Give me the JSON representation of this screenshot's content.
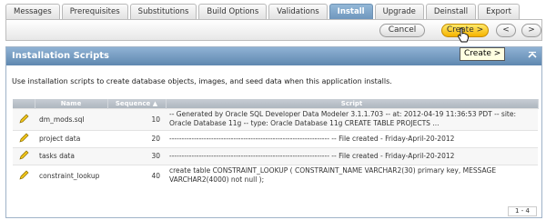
{
  "tabs": [
    "Messages",
    "Prerequisites",
    "Substitutions",
    "Build Options",
    "Validations",
    "Install",
    "Upgrade",
    "Deinstall",
    "Export"
  ],
  "active_tab": "Install",
  "toolbar": {
    "cancel_label": "Cancel",
    "create_label": "Create >",
    "prev_label": "<",
    "next_label": ">"
  },
  "tooltip": "Create >",
  "region": {
    "title": "Installation Scripts",
    "intro": "Use installation scripts to create database objects, images, and seed data when this application installs."
  },
  "table": {
    "headers": [
      "",
      "Name",
      "Sequence",
      "Script"
    ],
    "sort_indicator": "▲",
    "rows": [
      {
        "name": "dm_mods.sql",
        "sequence": "10",
        "script": "-- Generated by Oracle SQL Developer Data Modeler 3.1.1.703 -- at: 2012-04-19 11:36:53 PDT -- site: Oracle Database 11g -- type: Oracle Database 11g CREATE TABLE PROJECTS ..."
      },
      {
        "name": "project data",
        "sequence": "20",
        "script": "----------------------------------------------------------------- -- File created - Friday-April-20-2012"
      },
      {
        "name": "tasks data",
        "sequence": "30",
        "script": "----------------------------------------------------------------- -- File created - Friday-April-20-2012"
      },
      {
        "name": "constraint_lookup",
        "sequence": "40",
        "script": "create table CONSTRAINT_LOOKUP ( CONSTRAINT_NAME VARCHAR2(30) primary key, MESSAGE VARCHAR2(4000) not null );"
      }
    ],
    "pagination": "1 - 4"
  },
  "colors": {
    "active_tab": "#7ea3c7",
    "region_header": "#6f97bd",
    "create_button": "#f5b400",
    "tooltip_bg": "#ffffe1",
    "pencil": "#e6b800"
  }
}
